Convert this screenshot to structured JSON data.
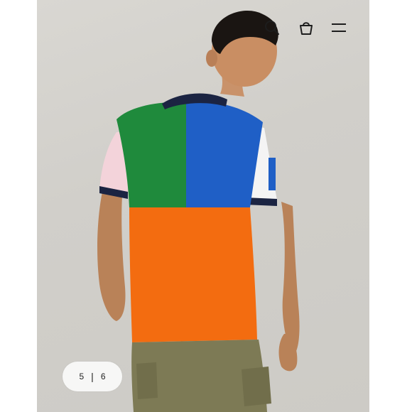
{
  "header": {
    "icons": [
      "search-icon",
      "shopping-bag-icon",
      "menu-icon"
    ]
  },
  "gallery": {
    "current": "5",
    "separator": "|",
    "total": "6"
  },
  "product_photo": {
    "subject": "man-back-view-colorblock-polo",
    "shirt_colors": {
      "green": "#1f8a3c",
      "blue": "#1f5fc6",
      "orange": "#f36c10",
      "navy": "#1b2442",
      "white_sleeve": "#f4f4f4",
      "pink_sleeve": "#f4d5dc",
      "pants": "#7d7a55"
    }
  }
}
